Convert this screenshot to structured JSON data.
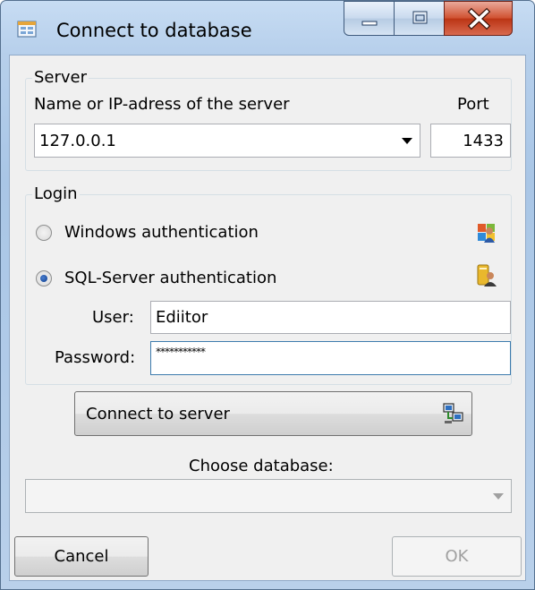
{
  "window": {
    "title": "Connect to database"
  },
  "server": {
    "group_label": "Server",
    "name_label": "Name or IP-adress of the server",
    "port_label": "Port",
    "name_value": "127.0.0.1",
    "port_value": "1433"
  },
  "login": {
    "group_label": "Login",
    "windows_auth_label": "Windows authentication",
    "sql_auth_label": "SQL-Server authentication",
    "selected": "sql",
    "user_label": "User:",
    "user_value": "Ediitor",
    "password_label": "Password:",
    "password_value": "***********"
  },
  "actions": {
    "connect_label": "Connect to server",
    "choose_db_label": "Choose database:",
    "database_value": "",
    "cancel_label": "Cancel",
    "ok_label": "OK"
  }
}
